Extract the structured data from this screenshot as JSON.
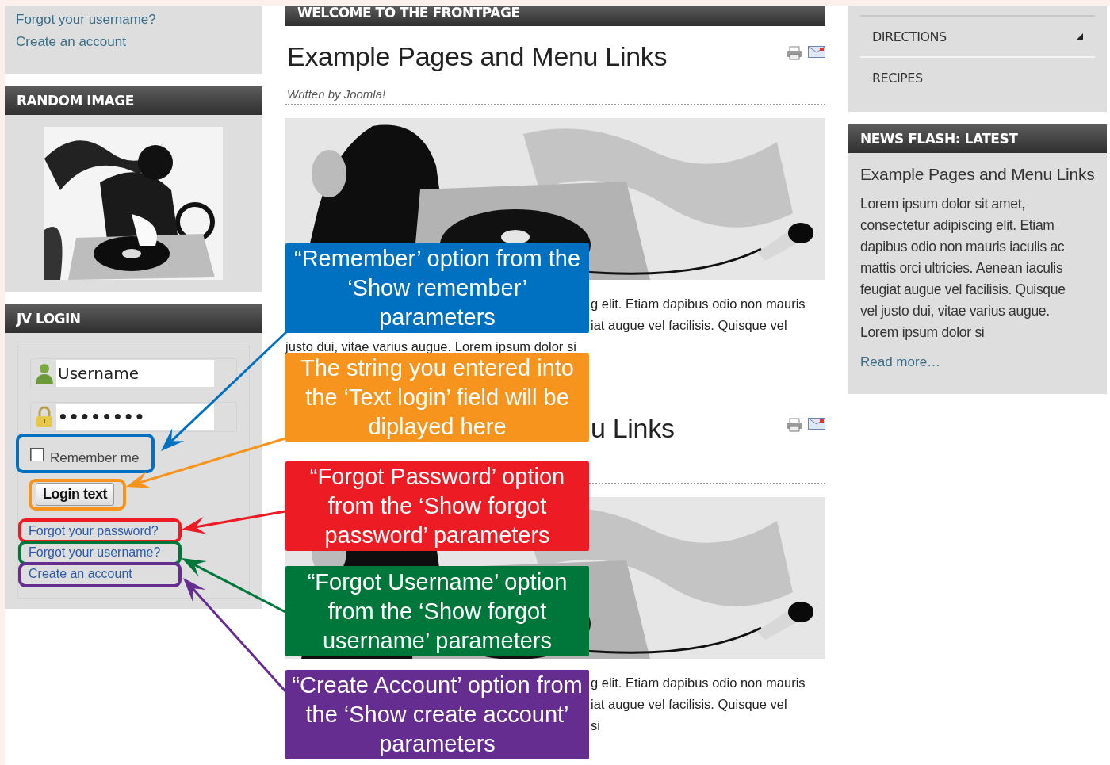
{
  "left_column": {
    "top_links": [
      "Forgot your username?",
      "Create an account"
    ],
    "random_image": {
      "title": "RANDOM IMAGE",
      "kind": "picture"
    },
    "login": {
      "title": "JV LOGIN",
      "username": {
        "value": "Username"
      },
      "password": {
        "value": "••••••••"
      },
      "remember": {
        "label": "Remember me",
        "checked": false
      },
      "button": "Login text",
      "links": [
        "Forgot your password?",
        "Forgot your username?",
        "Create an account"
      ]
    }
  },
  "main": {
    "header": "WELCOME TO THE FRONTPAGE",
    "articles": [
      {
        "title": "Example Pages and Menu Links",
        "author": "Written by Joomla!",
        "lines": [
          "g elit. Etiam dapibus odio non mauris",
          "iat augue vel facilisis. Quisque vel",
          "justo dui, vitae varius augue. Lorem ipsum dolor si"
        ]
      },
      {
        "title": "u Links",
        "lines": [
          "g elit. Etiam dapibus odio non mauris",
          "iat augue vel facilisis. Quisque vel",
          "si"
        ]
      }
    ]
  },
  "right_column": {
    "menu": [
      {
        "label": "DIRECTIONS",
        "kind": "submenu"
      },
      {
        "label": "RECIPES",
        "kind": "link"
      }
    ],
    "news_flash": {
      "title": "NEWS FLASH: LATEST",
      "headline": "Example Pages and Menu Links",
      "text": "Lorem ipsum dolor sit amet, consectetur adipiscing elit. Etiam dapibus odio non mauris iaculis ac mattis orci ultricies. Aenean iaculis feugiat augue vel facilisis. Quisque vel justo dui, vitae varius augue. Lorem ipsum dolor si",
      "read_more": "Read more…"
    }
  },
  "callouts": [
    {
      "text": "“Remember’ option from the ‘Show remember’ parameters",
      "color": "#0070c0"
    },
    {
      "text": "The string you entered into the ‘Text login’ field will be diplayed here",
      "color": "#f7941d"
    },
    {
      "text": "“Forgot Password’ option from the ‘Show forgot password’ parameters",
      "color": "#ed1c24"
    },
    {
      "text": "“Forgot Username’ option from the ‘Show forgot username’ parameters",
      "color": "#00773a"
    },
    {
      "text": "“Create Account’ option from the ‘Show create account’ parameters",
      "color": "#662d91"
    }
  ]
}
